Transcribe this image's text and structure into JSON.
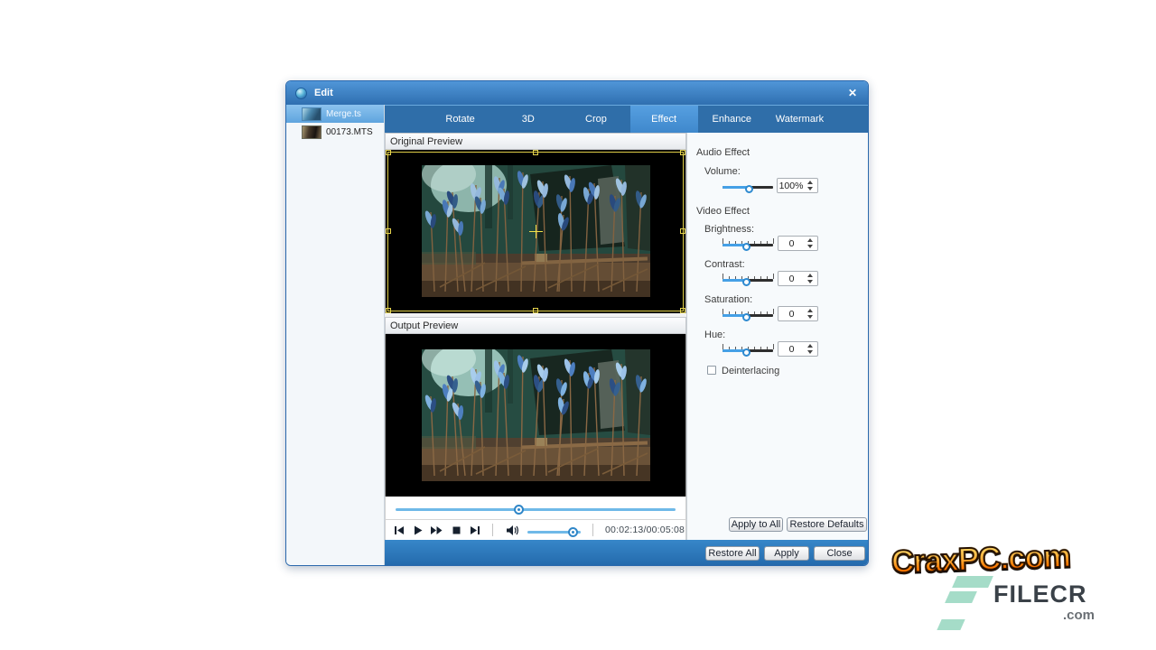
{
  "window": {
    "title": "Edit",
    "close_glyph": "✕"
  },
  "files": [
    {
      "name": "Merge.ts",
      "selected": true
    },
    {
      "name": "00173.MTS",
      "selected": false
    }
  ],
  "tabs": [
    {
      "label": "Rotate",
      "active": false
    },
    {
      "label": "3D",
      "active": false
    },
    {
      "label": "Crop",
      "active": false
    },
    {
      "label": "Effect",
      "active": true
    },
    {
      "label": "Enhance",
      "active": false
    },
    {
      "label": "Watermark",
      "active": false
    }
  ],
  "previews": {
    "original_label": "Original Preview",
    "output_label": "Output Preview"
  },
  "playback": {
    "timecode": "00:02:13/00:05:08",
    "seek_position_pct": 44,
    "volume_position_pct": 85
  },
  "effects": {
    "audio_section": "Audio Effect",
    "volume_label": "Volume:",
    "volume_value": "100%",
    "volume_handle_pct": 55,
    "video_section": "Video Effect",
    "sliders": [
      {
        "label": "Brightness:",
        "value": "0"
      },
      {
        "label": "Contrast:",
        "value": "0"
      },
      {
        "label": "Saturation:",
        "value": "0"
      },
      {
        "label": "Hue:",
        "value": "0"
      }
    ],
    "deinterlacing_label": "Deinterlacing",
    "apply_to_all_label": "Apply to All",
    "restore_defaults_label": "Restore Defaults"
  },
  "footer": {
    "restore_all_label": "Restore All",
    "apply_label": "Apply",
    "close_label": "Close"
  },
  "watermark": {
    "line1": "CraxPC.com",
    "line2": "FILECR",
    "line3": ".com"
  },
  "colors": {
    "titlebar_blue": "#3c7fc0",
    "tabstrip_blue": "#2f6ea9",
    "active_tab_blue": "#4a94d6",
    "accent_slider_blue": "#45a0e6",
    "crop_yellow": "#e0cf47",
    "flame_orange": "#ff8c00",
    "filecr_teal": "#a5dcc8"
  }
}
